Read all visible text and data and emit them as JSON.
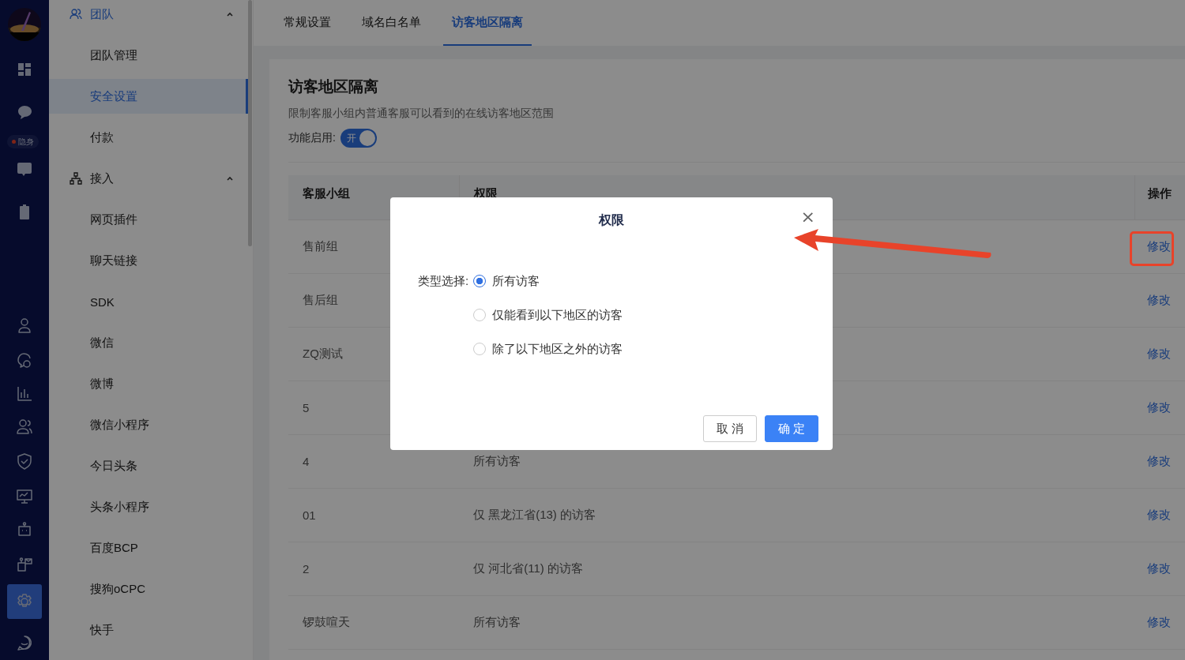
{
  "rail": {
    "badge": "隐身",
    "items": [
      {
        "selected": false
      },
      {
        "selected": false
      },
      {
        "selected": false
      },
      {
        "selected": false
      },
      {
        "selected": false
      },
      {
        "selected": false
      },
      {
        "selected": false
      },
      {
        "selected": false
      },
      {
        "selected": false
      },
      {
        "selected": false
      },
      {
        "selected": false
      },
      {
        "selected": false
      },
      {
        "selected": true
      },
      {
        "selected": false
      }
    ]
  },
  "sidebar": {
    "groups": [
      {
        "label": "团队",
        "expanded": true,
        "children": [
          {
            "label": "团队管理",
            "selected": false
          },
          {
            "label": "安全设置",
            "selected": true
          },
          {
            "label": "付款",
            "selected": false
          }
        ]
      },
      {
        "label": "接入",
        "expanded": true,
        "children": [
          {
            "label": "网页插件",
            "selected": false
          },
          {
            "label": "聊天链接",
            "selected": false
          },
          {
            "label": "SDK",
            "selected": false
          },
          {
            "label": "微信",
            "selected": false
          },
          {
            "label": "微博",
            "selected": false
          },
          {
            "label": "微信小程序",
            "selected": false
          },
          {
            "label": "今日头条",
            "selected": false
          },
          {
            "label": "头条小程序",
            "selected": false
          },
          {
            "label": "百度BCP",
            "selected": false
          },
          {
            "label": "搜狗oCPC",
            "selected": false
          },
          {
            "label": "快手",
            "selected": false
          }
        ]
      }
    ]
  },
  "tabs": [
    {
      "label": "常规设置",
      "selected": false
    },
    {
      "label": "域名白名单",
      "selected": false
    },
    {
      "label": "访客地区隔离",
      "selected": true
    }
  ],
  "section": {
    "title": "访客地区隔离",
    "description": "限制客服小组内普通客服可以看到的在线访客地区范围",
    "toggle": {
      "label": "功能启用:",
      "text": "开",
      "on": true
    }
  },
  "table": {
    "columns": [
      "客服小组",
      "权限",
      "操作"
    ],
    "rows": [
      {
        "group": "售前组",
        "action": "修改",
        "highlighted": true
      },
      {
        "group": "售后组",
        "action": "修改",
        "highlighted": false
      },
      {
        "group": "ZQ测试",
        "action": "修改",
        "highlighted": false
      },
      {
        "group": "5",
        "action": "修改",
        "highlighted": false
      },
      {
        "group": "4",
        "permission": "所有访客",
        "action": "修改",
        "highlighted": false
      },
      {
        "group": "01",
        "permission": "仅 黑龙江省(13) 的访客",
        "action": "修改",
        "highlighted": false
      },
      {
        "group": "2",
        "permission": "仅 河北省(11) 的访客",
        "action": "修改",
        "highlighted": false
      },
      {
        "group": "锣鼓喧天",
        "permission": "所有访客",
        "action": "修改",
        "highlighted": false
      }
    ]
  },
  "dialog": {
    "title": "权限",
    "close": "×",
    "field_label": "类型选择:",
    "options": [
      {
        "label": "所有访客",
        "selected": true
      },
      {
        "label": "仅能看到以下地区的访客",
        "selected": false
      },
      {
        "label": "除了以下地区之外的访客",
        "selected": false
      }
    ],
    "buttons": [
      {
        "label": "取 消",
        "kind": "secondary"
      },
      {
        "label": "确 定",
        "kind": "primary"
      }
    ]
  }
}
